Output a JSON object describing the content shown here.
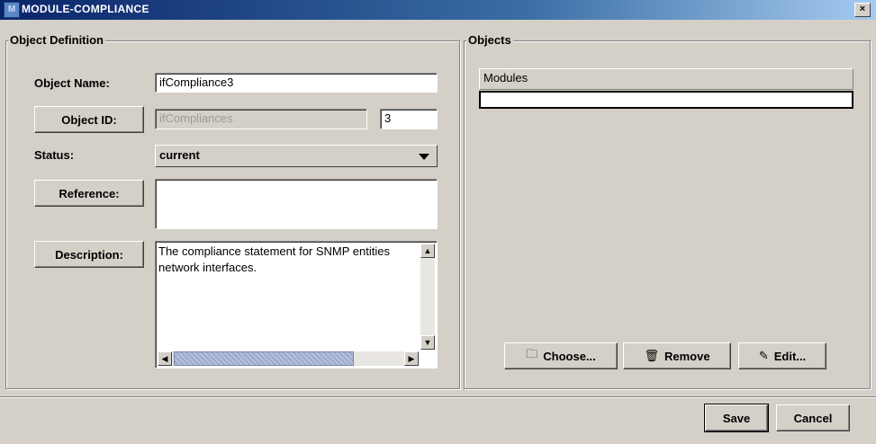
{
  "window": {
    "title": "MODULE-COMPLIANCE",
    "icon_text": "M",
    "close_label": "×"
  },
  "object_definition": {
    "group_title": "Object Definition",
    "object_name_label": "Object Name:",
    "object_name_value": "ifCompliance3",
    "object_id_button": "Object ID:",
    "object_id_parent": "ifCompliances",
    "object_id_number": "3",
    "status_label": "Status:",
    "status_value": "current",
    "reference_button": "Reference:",
    "reference_value": "",
    "description_button": "Description:",
    "description_line1": "The compliance statement for SNMP entities",
    "description_line2": "network interfaces."
  },
  "objects": {
    "group_title": "Objects",
    "column_header": "Modules",
    "choose_label": "Choose...",
    "remove_label": "Remove",
    "edit_label": "Edit..."
  },
  "footer": {
    "save_label": "Save",
    "cancel_label": "Cancel"
  },
  "icons": {
    "choose": "folder-icon",
    "remove": "trash-icon",
    "edit": "pencil-icon"
  }
}
